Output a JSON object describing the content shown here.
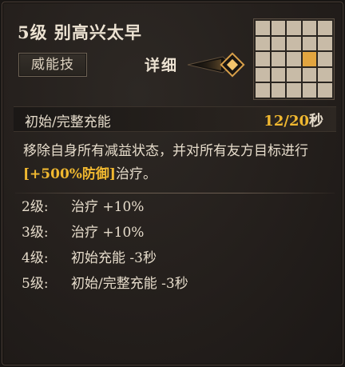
{
  "header": {
    "title": "5级  别高兴太早",
    "badge": "威能技",
    "detail_label": "详细",
    "detail_icon": "diamond-icon"
  },
  "range_grid": {
    "rows": 5,
    "cols": 5,
    "active_cells": [
      [
        2,
        3
      ]
    ],
    "cell_color": "#c8bba7",
    "active_color": "#e2a540"
  },
  "cooldown": {
    "label": "初始/完整充能",
    "initial": "12",
    "separator": "/",
    "full": "20",
    "unit": "秒"
  },
  "description": {
    "part1": "移除自身所有减益状态，并对所有友方目标进行",
    "highlight": "[+500%防御]",
    "part2": "治疗。"
  },
  "levels": [
    {
      "level": "2级:",
      "effect": "治疗 +10%"
    },
    {
      "level": "3级:",
      "effect": "治疗 +10%"
    },
    {
      "level": "4级:",
      "effect": "初始充能 -3秒"
    },
    {
      "level": "5级:",
      "effect": "初始/完整充能 -3秒"
    }
  ],
  "colors": {
    "accent": "#f0b830",
    "text": "#e6dccb",
    "background": "#241f1c"
  }
}
